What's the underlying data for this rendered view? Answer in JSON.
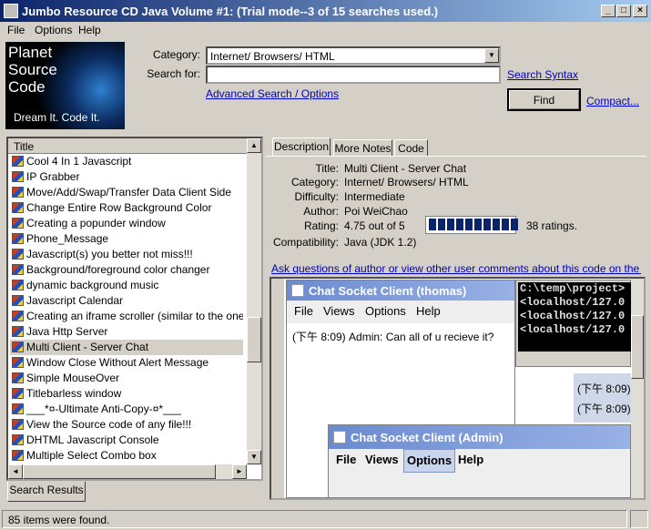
{
  "window": {
    "title": "Jumbo Resource CD Java Volume #1: (Trial mode--3 of 15 searches used.)"
  },
  "menu": [
    "File",
    "Options",
    "Help"
  ],
  "logo": {
    "lines": [
      "Planet",
      "Source",
      "Code"
    ],
    "tagline": "Dream It.  Code It."
  },
  "search": {
    "category_label": "Category:",
    "category_value": "Internet/ Browsers/ HTML",
    "search_label": "Search for:",
    "search_value": "",
    "search_syntax_link": "Search Syntax",
    "advanced_link": "Advanced Search / Options",
    "find_button": "Find",
    "compact_link": "Compact..."
  },
  "results": {
    "header": "Title",
    "items": [
      "Cool 4 In 1 Javascript",
      "IP Grabber",
      "Move/Add/Swap/Transfer Data Client Side",
      "Change Entire Row Background Color",
      "Creating a popunder window",
      "Phone_Message",
      "Javascript(s) you better not miss!!!",
      "Background/foreground color changer",
      "dynamic background music",
      "Javascript Calendar",
      "Creating an iframe scroller (similar to the one used b",
      "Java Http Server",
      "Multi Client - Server Chat",
      "Window Close Without Alert Message",
      "Simple MouseOver",
      "Titlebarless window",
      "___*¤-Ultimate Anti-Copy-¤*___",
      "View the Source code of any file!!!",
      "DHTML Javascript Console",
      "Multiple Select Combo box"
    ],
    "selected_index": 12,
    "tab_label": "Search Results"
  },
  "detail": {
    "tabs": [
      "Description",
      "More Notes",
      "Code"
    ],
    "active_tab": 0,
    "title_label": "Title:",
    "title_value": "Multi Client - Server Chat",
    "category_label": "Category:",
    "category_value": "Internet/ Browsers/ HTML",
    "difficulty_label": "Difficulty:",
    "difficulty_value": "Intermediate",
    "author_label": "Author:",
    "author_value": "Poi WeiChao",
    "rating_label": "Rating:",
    "rating_value": "4.75 out of 5",
    "rating_fraction": 0.95,
    "rating_count": "38 ratings.",
    "compat_label": "Compatibility:",
    "compat_value": "Java (JDK 1.2)",
    "ask_link": "Ask questions of author or view other user comments about this code on the web...."
  },
  "screenshot": {
    "win1_title": "Chat Socket Client (thomas)",
    "win1_menu": [
      "File",
      "Views",
      "Options",
      "Help"
    ],
    "win1_message": "(下午 8:09) Admin: Can all of u recieve it?",
    "console_lines": [
      "C:\\temp\\project>",
      "<localhost/127.0",
      "<localhost/127.0",
      "<localhost/127.0"
    ],
    "side_times": [
      "(下午 8:09)",
      "(下午 8:09)"
    ],
    "win2_title": "Chat Socket Client (Admin)",
    "win2_menu": [
      "File",
      "Views",
      "Options",
      "Help"
    ]
  },
  "status": {
    "text": "85 items were found."
  }
}
